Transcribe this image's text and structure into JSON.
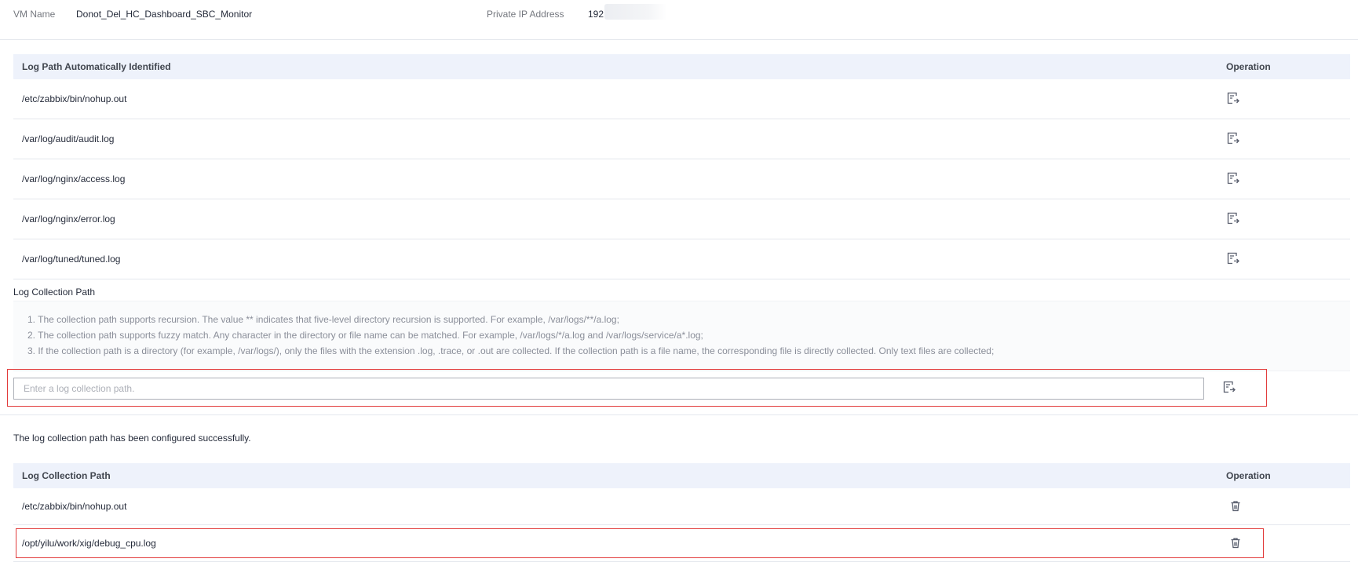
{
  "header": {
    "vm_name_label": "VM Name",
    "vm_name_value": "Donot_Del_HC_Dashboard_SBC_Monitor",
    "ip_label": "Private IP Address",
    "ip_value": "192"
  },
  "auto_table": {
    "col_path": "Log Path Automatically Identified",
    "col_operation": "Operation",
    "rows": [
      {
        "path": "/etc/zabbix/bin/nohup.out",
        "action_icon": "add-to-path-icon"
      },
      {
        "path": "/var/log/audit/audit.log",
        "action_icon": "add-to-path-icon"
      },
      {
        "path": "/var/log/nginx/access.log",
        "action_icon": "add-to-path-icon"
      },
      {
        "path": "/var/log/nginx/error.log",
        "action_icon": "add-to-path-icon"
      },
      {
        "path": "/var/log/tuned/tuned.log",
        "action_icon": "add-to-path-icon"
      }
    ]
  },
  "collection": {
    "title": "Log Collection Path",
    "tips": [
      "1. The collection path supports recursion. The value ** indicates that five-level directory recursion is supported. For example, /var/logs/**/a.log;",
      "2. The collection path supports fuzzy match. Any character in the directory or file name can be matched. For example, /var/logs/*/a.log and /var/logs/service/a*.log;",
      "3. If the collection path is a directory (for example, /var/logs/), only the files with the extension .log, .trace, or .out are collected. If the collection path is a file name, the corresponding file is directly collected. Only text files are collected;"
    ],
    "input_value": "",
    "input_placeholder": "Enter a log collection path."
  },
  "success_message": "The log collection path has been configured successfully.",
  "configured_table": {
    "col_path": "Log Collection Path",
    "col_operation": "Operation",
    "rows": [
      {
        "path": "/etc/zabbix/bin/nohup.out",
        "action_icon": "delete-icon"
      },
      {
        "path": "/opt/yilu/work/xig/debug_cpu.log",
        "action_icon": "delete-icon"
      }
    ]
  },
  "colors": {
    "header_bg": "#eef2fb",
    "highlight": "#e23c3c",
    "icon": "#575d6c"
  }
}
